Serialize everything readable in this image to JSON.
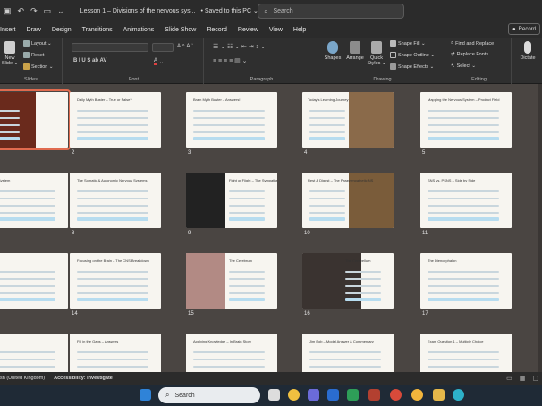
{
  "window": {
    "doc_title": "Lesson 1 – Divisions of the nervous sys...",
    "saved_status": "• Saved to this PC ⌄",
    "search_placeholder": "Search"
  },
  "menu_tabs": [
    "Insert",
    "Draw",
    "Design",
    "Transitions",
    "Animations",
    "Slide Show",
    "Record",
    "Review",
    "View",
    "Help"
  ],
  "record_button": "Record",
  "ribbon": {
    "slides_group": {
      "new_slide": "New Slide ⌄",
      "layout": "Layout ⌄",
      "reset": "Reset",
      "section": "Section ⌄",
      "label": "Slides"
    },
    "font_group": {
      "label": "Font",
      "format_buttons": "B  I  U  S  ab  AV"
    },
    "paragraph_group": {
      "label": "Paragraph"
    },
    "drawing_group": {
      "shapes": "Shapes",
      "arrange": "Arrange",
      "quick_styles": "Quick Styles ⌄",
      "shape_fill": "Shape Fill ⌄",
      "shape_outline": "Shape Outline ⌄",
      "shape_effects": "Shape Effects ⌄",
      "label": "Drawing"
    },
    "editing_group": {
      "find_replace": "Find and Replace",
      "replace_fonts": "Replace Fonts",
      "select": "Select ⌄",
      "label": "Editing"
    },
    "voice_group": {
      "dictate": "Dictate"
    }
  },
  "slides": [
    {
      "num": "",
      "title": "",
      "photo": "brain"
    },
    {
      "num": "2",
      "title": "Daily Myth Buster – True or False?"
    },
    {
      "num": "3",
      "title": "Brain Myth Buster – Answers!"
    },
    {
      "num": "4",
      "title": "Today's Learning Journey"
    },
    {
      "num": "5",
      "title": "Mapping the Nervous System – Product Field"
    },
    {
      "num": "",
      "title": "Nervous System"
    },
    {
      "num": "8",
      "title": "The Somatic & Autonomic Nervous Systems"
    },
    {
      "num": "9",
      "title": "Fight or Flight – The Sympathetic NS"
    },
    {
      "num": "10",
      "title": "Rest & Digest – The Parasympathetic NS"
    },
    {
      "num": "11",
      "title": "SNS vs. PSNS – Side by Side"
    },
    {
      "num": "",
      "title": "d Answer"
    },
    {
      "num": "14",
      "title": "Focusing on the Brain – The CNS Breakdown"
    },
    {
      "num": "15",
      "title": "The Cerebrum"
    },
    {
      "num": "16",
      "title": "The Cerebellum"
    },
    {
      "num": "17",
      "title": "The Diencephalon"
    },
    {
      "num": "",
      "title": "ision"
    },
    {
      "num": "",
      "title": "Fill in the Gaps – Answers"
    },
    {
      "num": "",
      "title": "Applying Knowledge – In Brain Story"
    },
    {
      "num": "",
      "title": "Jim Bob – Model Answer & Commentary"
    },
    {
      "num": "",
      "title": "Exam Question 1 – Multiple Choice"
    }
  ],
  "status": {
    "language": "sh (United Kingdom)",
    "accessibility": "Accessibility: Investigate"
  },
  "taskbar": {
    "search": "Search"
  }
}
